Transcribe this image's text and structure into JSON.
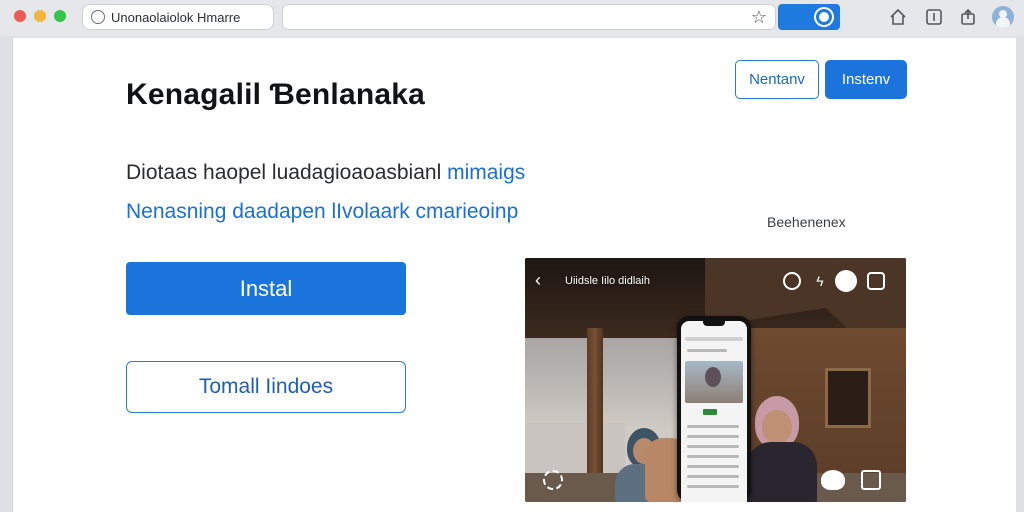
{
  "browser": {
    "tab_title": "Unonaolaiolok Hmarre",
    "address_value": "",
    "icons": [
      "tab-favicon-icon",
      "star-icon",
      "address-action-icon",
      "home-icon",
      "reader-icon",
      "share-icon",
      "profile-avatar"
    ]
  },
  "header": {
    "outline_button": "Nentanv",
    "fill_button": "Instenv"
  },
  "main": {
    "title": "Kenagalil Ɓenlanaka",
    "desc_line1_text": "Diotaas haopel luadagioaoasbianl ",
    "desc_line1_link": "mimaigs",
    "desc_line2": "Nenasning daadapen lIvolaark cmarieoinp",
    "install_button": "Instal",
    "secondary_button": "Tomall Iindoes"
  },
  "preview": {
    "caption": "Beehenenex",
    "overlay_title": "Uiidsle  Iilo  didlaih",
    "colors": {
      "accent": "#1a74dc",
      "link": "#1a6fd8"
    }
  }
}
